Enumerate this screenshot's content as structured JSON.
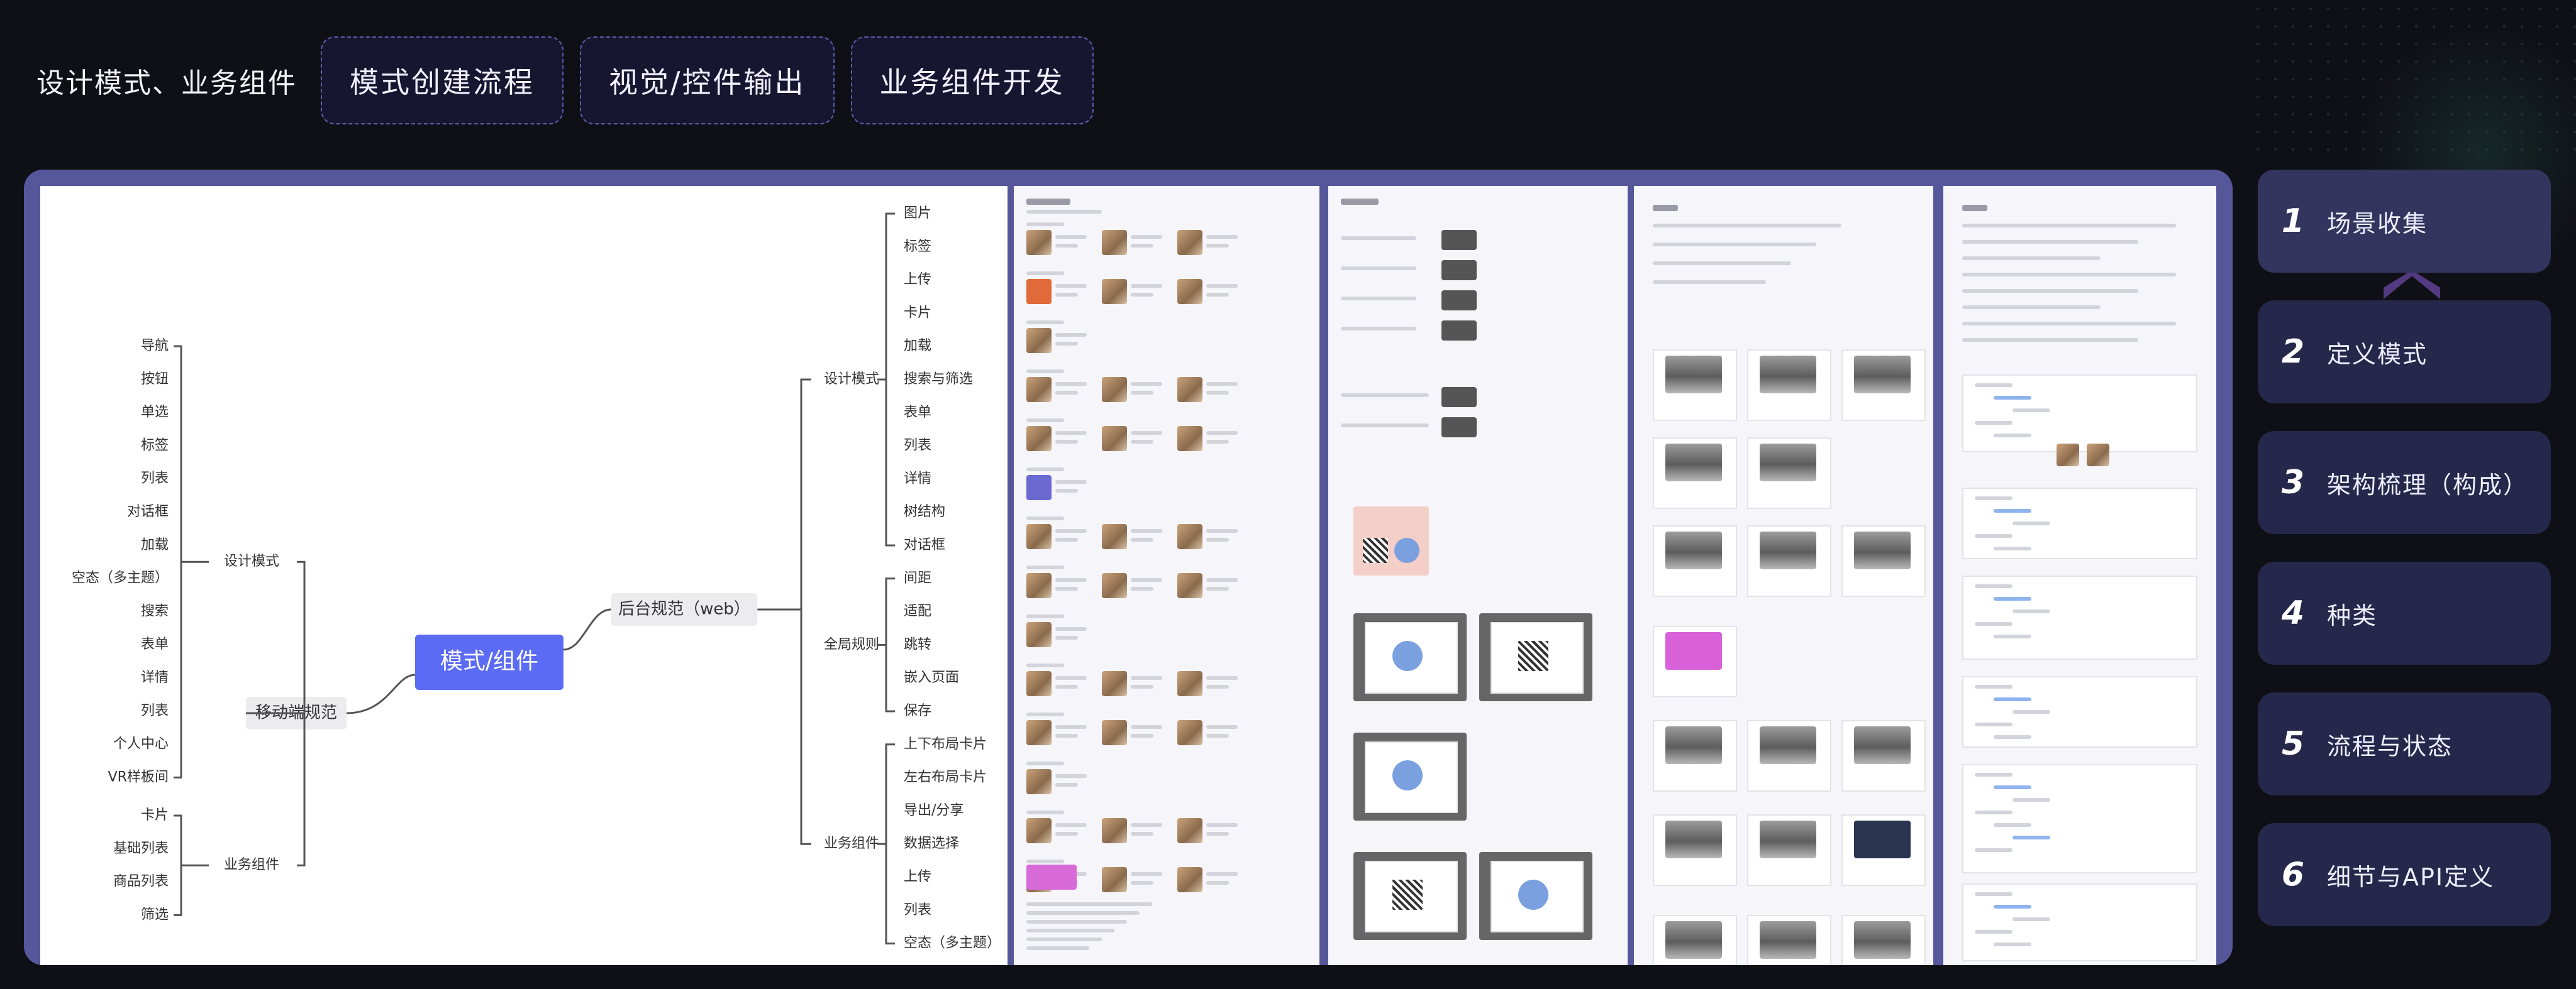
{
  "header": {
    "title": "设计模式、业务组件",
    "tabs": [
      "模式创建流程",
      "视觉/控件输出",
      "业务组件开发"
    ]
  },
  "mindmap": {
    "center": "模式/组件",
    "left_hub": "移动端规范",
    "right_hub": "后台规范（web）",
    "left_groups": [
      {
        "label": "设计模式",
        "items": [
          "导航",
          "按钮",
          "单选",
          "标签",
          "列表",
          "对话框",
          "加载",
          "空态（多主题）",
          "搜索",
          "表单",
          "详情",
          "列表",
          "个人中心",
          "VR样板间"
        ]
      },
      {
        "label": "业务组件",
        "items": [
          "卡片",
          "基础列表",
          "商品列表",
          "筛选"
        ]
      }
    ],
    "right_groups": [
      {
        "label": "设计模式",
        "items": [
          "图片",
          "标签",
          "上传",
          "卡片",
          "加载",
          "搜索与筛选",
          "表单",
          "列表",
          "详情",
          "树结构",
          "对话框"
        ]
      },
      {
        "label": "全局规则",
        "items": [
          "间距",
          "适配",
          "跳转",
          "嵌入页面",
          "保存"
        ]
      },
      {
        "label": "业务组件",
        "items": [
          "上下布局卡片",
          "左右布局卡片",
          "导出/分享",
          "数据选择",
          "上传",
          "列表",
          "空态（多主题）"
        ]
      }
    ]
  },
  "steps": [
    {
      "num": "1",
      "label": "场景收集"
    },
    {
      "num": "2",
      "label": "定义模式"
    },
    {
      "num": "3",
      "label": "架构梳理（构成）"
    },
    {
      "num": "4",
      "label": "种类"
    },
    {
      "num": "5",
      "label": "流程与状态"
    },
    {
      "num": "6",
      "label": "细节与API定义"
    }
  ],
  "colors": {
    "accent": "#5b6bf5",
    "panel": "#55579a",
    "step_bg": "#25274b",
    "background": "#0f0f16"
  }
}
